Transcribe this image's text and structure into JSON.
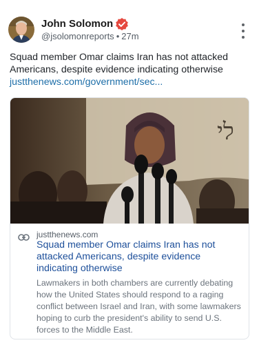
{
  "author": {
    "name": "John Solomon",
    "handle": "@jsolomonreports",
    "time": "27m",
    "verified_color": "#e5483f"
  },
  "post": {
    "text": "Squad member Omar claims Iran has not attacked Americans, despite evidence indicating otherwise",
    "link_text": "justthenews.com/government/sec..."
  },
  "card": {
    "domain": "justthenews.com",
    "title": "Squad member Omar claims Iran has not attacked Americans, despite evidence indicating otherwise",
    "description": "Lawmakers in both chambers are currently debating how the United States should respond to a raging conflict between Israel and Iran, with some lawmakers hoping to curb the president's ability to send U.S. forces to the Middle East."
  },
  "icons": {
    "verified": "verified-badge-icon",
    "more": "more-vertical-icon",
    "link": "link-icon"
  },
  "colors": {
    "link": "#1d6ea8",
    "card_title": "#1d4f9a",
    "muted": "#6b737c"
  }
}
